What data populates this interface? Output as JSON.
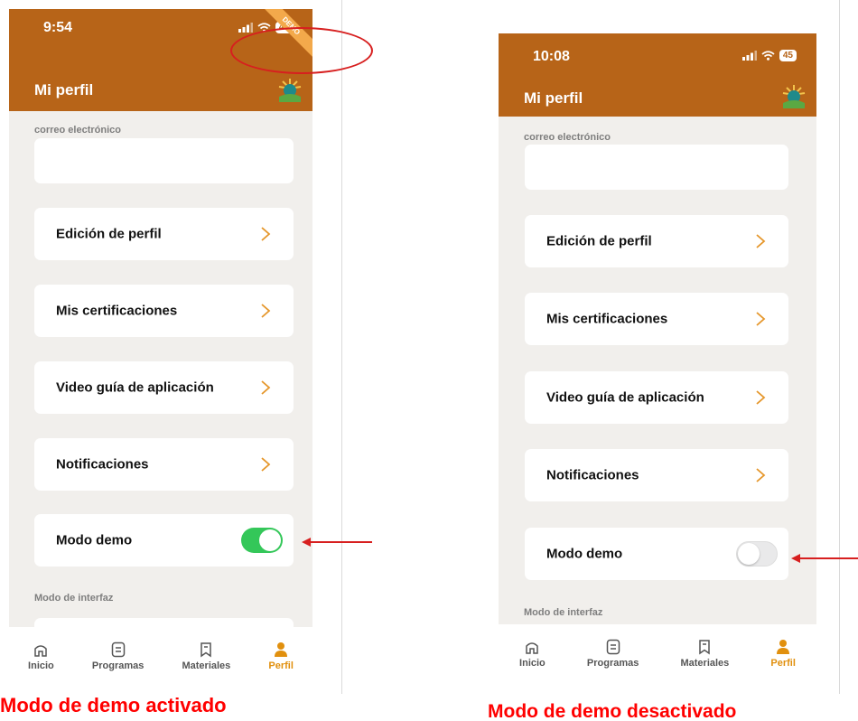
{
  "left_phone": {
    "status_time": "9:54",
    "battery": "46",
    "demo_ribbon": "DEMO",
    "header_title": "Mi perfil",
    "email_label": "correo electrónico",
    "menu": [
      "Edición de perfil",
      "Mis certificaciones",
      "Video guía de aplicación",
      "Notificaciones"
    ],
    "demo_label": "Modo demo",
    "demo_state": "on",
    "interface_label": "Modo de interfaz",
    "tabs": [
      "Inicio",
      "Programas",
      "Materiales",
      "Perfil"
    ]
  },
  "right_phone": {
    "status_time": "10:08",
    "battery": "45",
    "header_title": "Mi perfil",
    "email_label": "correo electrónico",
    "menu": [
      "Edición de perfil",
      "Mis certificaciones",
      "Video guía de aplicación",
      "Notificaciones"
    ],
    "demo_label": "Modo demo",
    "demo_state": "off",
    "interface_label": "Modo de interfaz",
    "tabs": [
      "Inicio",
      "Programas",
      "Materiales",
      "Perfil"
    ]
  },
  "captions": {
    "left": "Modo de demo activado",
    "right": "Modo de demo desactivado"
  },
  "colors": {
    "header": "#b76418",
    "background": "#f1efec",
    "toggle_on": "#34c759",
    "tab_active": "#e1900e",
    "annotation": "#d71f1f",
    "caption": "#ff0000"
  }
}
